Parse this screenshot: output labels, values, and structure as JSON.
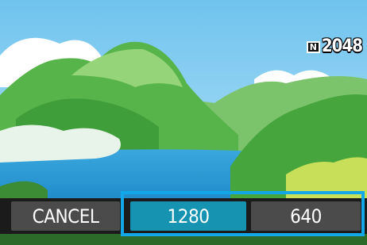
{
  "camera_screen": {
    "image_quality_icon": "N",
    "image_size": "2048"
  },
  "resize_menu": {
    "options": [
      {
        "label": "CANCEL",
        "selected": false
      },
      {
        "label": "1280",
        "selected": true
      },
      {
        "label": "640",
        "selected": false
      }
    ]
  },
  "colors": {
    "selection_highlight": "#1693b0",
    "selection_border": "#12a7e8",
    "option_background": "#4b4b4b"
  }
}
